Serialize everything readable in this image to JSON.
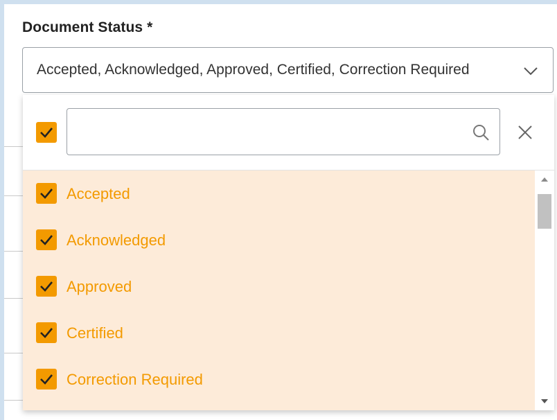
{
  "field": {
    "label": "Document Status *",
    "value": "Accepted, Acknowledged, Approved, Certified, Correction Required"
  },
  "dropdown": {
    "select_all_checked": true,
    "search": {
      "value": "",
      "placeholder": ""
    },
    "options": [
      {
        "label": "Accepted",
        "checked": true
      },
      {
        "label": "Acknowledged",
        "checked": true
      },
      {
        "label": "Approved",
        "checked": true
      },
      {
        "label": "Certified",
        "checked": true
      },
      {
        "label": "Correction Required",
        "checked": true
      }
    ],
    "icons": {
      "search": "search-icon",
      "close": "close-icon",
      "chevron": "chevron-down-icon",
      "check": "check-icon"
    }
  },
  "colors": {
    "accent": "#f39a00",
    "selected_row_bg": "#fdebd9",
    "border": "#9aa0a6",
    "frame_bg": "#cfe0ef"
  }
}
